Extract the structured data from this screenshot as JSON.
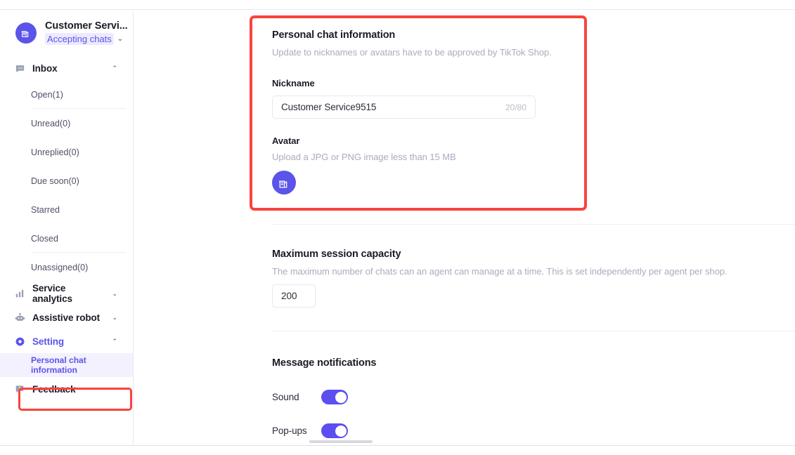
{
  "sidebar": {
    "profile": {
      "name": "Customer Servi...",
      "status": "Accepting chats",
      "status_chevron": "chevron-down",
      "avatar_icon": "shop-building-icon",
      "avatar_color": "#5b54e8",
      "status_badge_bg": "#eceaff",
      "status_badge_color": "#5b54e8"
    },
    "groups": [
      {
        "label": "Inbox",
        "icon": "chat-bubble-icon",
        "expanded": true,
        "caret": "chevron-up",
        "items": [
          {
            "label": "Open(1)",
            "divider_below": true
          },
          {
            "label": "Unread(0)",
            "divider_below": false
          },
          {
            "label": "Unreplied(0)",
            "divider_below": false
          },
          {
            "label": "Due soon(0)",
            "divider_below": false
          },
          {
            "label": "Starred",
            "divider_below": false
          },
          {
            "label": "Closed",
            "divider_below": true
          },
          {
            "label": "Unassigned(0)",
            "divider_below": false
          }
        ]
      },
      {
        "label": "Service analytics",
        "icon": "bar-chart-icon",
        "expanded": false,
        "caret": "chevron-down",
        "items": []
      },
      {
        "label": "Assistive robot",
        "icon": "robot-icon",
        "expanded": false,
        "caret": "chevron-down",
        "items": []
      },
      {
        "label": "Setting",
        "icon": "gear-icon",
        "expanded": true,
        "active": true,
        "caret": "chevron-up",
        "items": [
          {
            "label": "Personal chat information",
            "selected": true
          }
        ]
      },
      {
        "label": "Feedback",
        "icon": "feedback-icon",
        "expanded": false,
        "caret": "",
        "items": []
      }
    ]
  },
  "main": {
    "personal_chat": {
      "title": "Personal chat information",
      "description": "Update to nicknames or avatars have to be approved by TikTok Shop.",
      "nickname_label": "Nickname",
      "nickname_value": "Customer Service9515",
      "nickname_counter": "20/80",
      "avatar_label": "Avatar",
      "avatar_hint": "Upload a JPG or PNG image less than 15 MB",
      "avatar_icon": "shop-building-icon"
    },
    "session_capacity": {
      "title": "Maximum session capacity",
      "description": "The maximum number of chats can an agent can manage at a time. This is set independently per agent per shop.",
      "value": "200"
    },
    "notifications": {
      "title": "Message notifications",
      "toggles": [
        {
          "label": "Sound",
          "on": true
        },
        {
          "label": "Pop-ups",
          "on": true
        }
      ]
    }
  },
  "annotations": {
    "color": "#f8443c",
    "boxes": [
      "personal-chat-information-card",
      "sidebar-personal-chat-information-item"
    ]
  }
}
